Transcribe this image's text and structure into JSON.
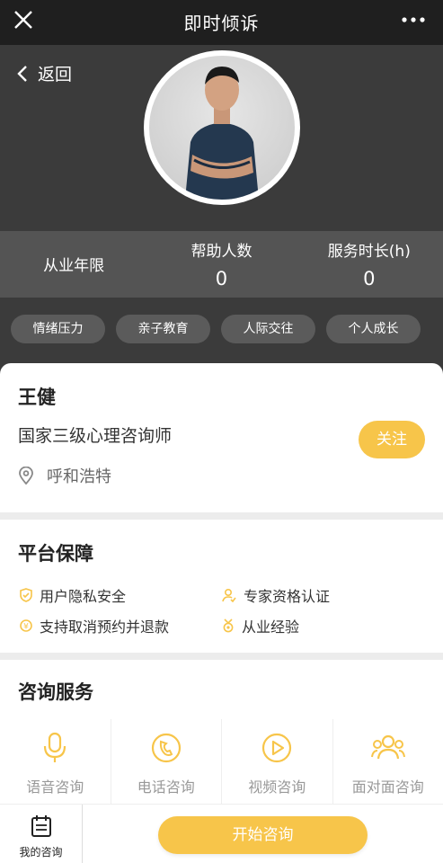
{
  "nav": {
    "title": "即时倾诉"
  },
  "header": {
    "back_label": "返回",
    "stats": [
      {
        "label": "从业年限",
        "value": ""
      },
      {
        "label": "帮助人数",
        "value": "0"
      },
      {
        "label": "服务时长(h)",
        "value": "0"
      }
    ],
    "tags": [
      "情绪压力",
      "亲子教育",
      "人际交往",
      "个人成长"
    ]
  },
  "profile": {
    "name": "王健",
    "title": "国家三级心理咨询师",
    "location": "呼和浩特",
    "follow_label": "关注"
  },
  "guarantee": {
    "title": "平台保障",
    "items": [
      "用户隐私安全",
      "专家资格认证",
      "支持取消预约并退款",
      "从业经验"
    ]
  },
  "consult": {
    "title": "咨询服务",
    "services": [
      "语音咨询",
      "电话咨询",
      "视频咨询",
      "面对面咨询"
    ]
  },
  "bottom": {
    "my_label": "我的咨询",
    "start_label": "开始咨询"
  },
  "colors": {
    "accent": "#f7c54a",
    "header_bg": "#3b3b3b",
    "nav_bg": "#1f1f1f"
  }
}
